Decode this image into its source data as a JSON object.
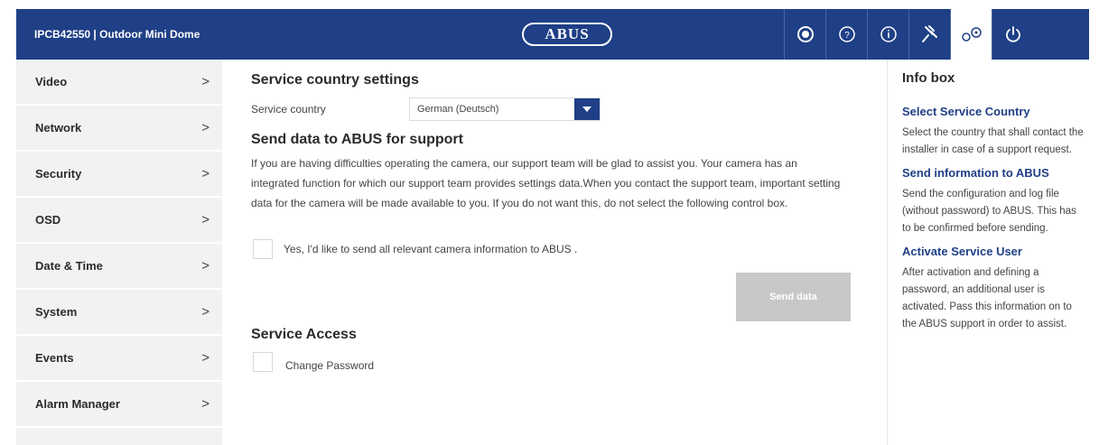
{
  "header": {
    "model": "IPCB42550  |  Outdoor Mini Dome",
    "logo": "ABUS",
    "icons": [
      "lens-icon",
      "help-icon",
      "info-icon",
      "pin-icon",
      "settings-icon",
      "power-icon"
    ],
    "active_icon": "settings-icon",
    "accent": "#1f3f86"
  },
  "sidebar": {
    "items": [
      {
        "label": "Video",
        "chevron": ">"
      },
      {
        "label": "Network",
        "chevron": ">"
      },
      {
        "label": "Security",
        "chevron": ">"
      },
      {
        "label": "OSD",
        "chevron": ">"
      },
      {
        "label": "Date & Time",
        "chevron": ">"
      },
      {
        "label": "System",
        "chevron": ">"
      },
      {
        "label": "Events",
        "chevron": ">"
      },
      {
        "label": "Alarm Manager",
        "chevron": ">"
      }
    ]
  },
  "main": {
    "service_country": {
      "heading": "Service country settings",
      "label": "Service country",
      "value": "German (Deutsch)"
    },
    "support": {
      "heading": "Send data to ABUS for support",
      "description": "If you are having difficulties operating the camera, our support team will be glad to assist you. Your camera has an integrated function for which our support team provides settings data.When you contact the support team, important setting data for the camera will be made available to you. If you do not want this, do not select the following control box.",
      "checkbox_label": "Yes, I'd like to send all relevant camera information to ABUS .",
      "checked": false,
      "send_button": "Send data"
    },
    "service_access": {
      "heading": "Service Access",
      "checkbox_label": "Change Password",
      "checked": false
    }
  },
  "info": {
    "title": "Info box",
    "sections": [
      {
        "heading": "Select Service Country",
        "text": "Select the country that shall contact the installer in case of a support request."
      },
      {
        "heading": "Send information to ABUS",
        "text": "Send the configuration and log file (without password) to ABUS. This has to be confirmed before sending."
      },
      {
        "heading": "Activate Service User",
        "text": "After activation and defining a password, an additional user is activated. Pass this information on to the ABUS support in order to assist."
      }
    ]
  }
}
